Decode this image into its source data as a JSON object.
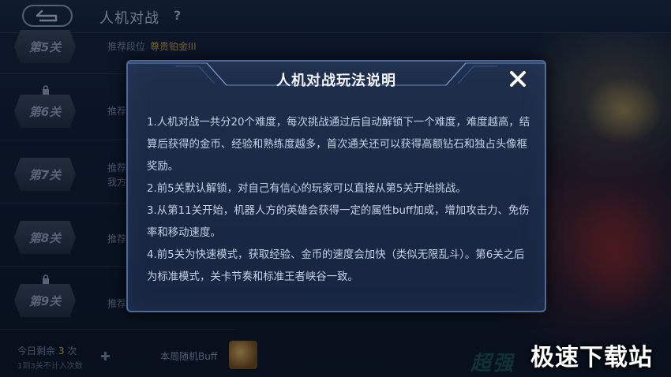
{
  "header": {
    "title": "人机对战",
    "help": "?"
  },
  "levels": [
    {
      "label": "第5关",
      "line1": "推荐段位",
      "rank": "尊贵铂金III",
      "locked": false
    },
    {
      "label": "第6关",
      "line1": "推荐",
      "locked": true
    },
    {
      "label": "第7关",
      "line1": "推荐",
      "line2": "我方",
      "locked": false
    },
    {
      "label": "第8关",
      "line1": "推荐",
      "locked": false
    },
    {
      "label": "第9关",
      "line1": "推荐",
      "locked": true
    }
  ],
  "footer": {
    "remaining_prefix": "今日剩余",
    "remaining_count": "3",
    "remaining_suffix": "次",
    "note": "1到3关不计入次数",
    "weekly_buff": "本周随机Buff"
  },
  "promo_text": "超强",
  "watermark": "极速下载站",
  "modal": {
    "title": "人机对战玩法说明",
    "paragraphs": [
      "1.人机对战一共分20个难度，每次挑战通过后自动解锁下一个难度，难度越高，结算后获得的金币、经验和熟练度越多，首次通关还可以获得高额钻石和独占头像框奖励。",
      "2.前5关默认解锁，对自己有信心的玩家可以直接从第5关开始挑战。",
      "3.从第11关开始，机器人方的英雄会获得一定的属性buff加成，增加攻击力、免伤率和移动速度。",
      "4.前5关为快速模式，获取经验、金币的速度会加快（类似无限乱斗）。第6关之后为标准模式，关卡节奏和标准王者峡谷一致。"
    ]
  },
  "icons": {
    "back": "back-arrow-icon",
    "close": "close-icon",
    "lock": "lock-icon",
    "plus": "plus-icon"
  },
  "colors": {
    "accent_gold": "#d7a94a",
    "modal_border": "#4f6a96"
  }
}
